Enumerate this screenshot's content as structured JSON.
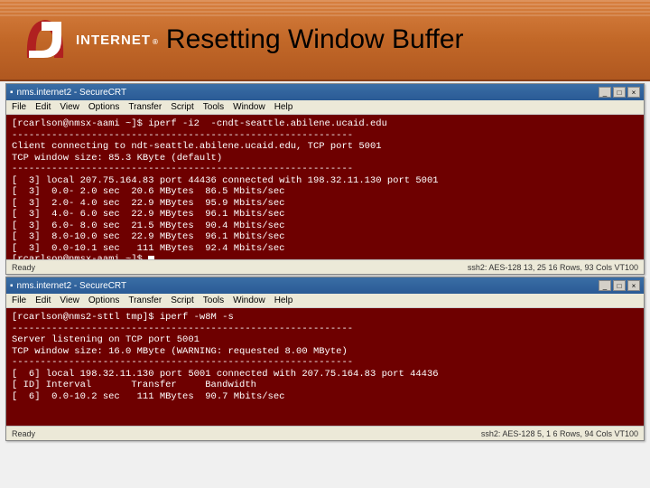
{
  "header": {
    "logo_word": "INTERNET",
    "logo_reg": "®",
    "title": "Resetting Window Buffer"
  },
  "term1": {
    "titlebar": "nms.internet2 - SecureCRT",
    "menus": [
      "File",
      "Edit",
      "View",
      "Options",
      "Transfer",
      "Script",
      "Tools",
      "Window",
      "Help"
    ],
    "lines": [
      "[rcarlson@nmsx-aami ~]$ iperf -i2  -cndt-seattle.abilene.ucaid.edu",
      "------------------------------------------------------------",
      "Client connecting to ndt-seattle.abilene.ucaid.edu, TCP port 5001",
      "TCP window size: 85.3 KByte (default)",
      "------------------------------------------------------------",
      "[  3] local 207.75.164.83 port 44436 connected with 198.32.11.130 port 5001",
      "[  3]  0.0- 2.0 sec  20.6 MBytes  86.5 Mbits/sec",
      "[  3]  2.0- 4.0 sec  22.9 MBytes  95.9 Mbits/sec",
      "[  3]  4.0- 6.0 sec  22.9 MBytes  96.1 Mbits/sec",
      "[  3]  6.0- 8.0 sec  21.5 MBytes  90.4 Mbits/sec",
      "[  3]  8.0-10.0 sec  22.9 MBytes  96.1 Mbits/sec",
      "[  3]  0.0-10.1 sec   111 MBytes  92.4 Mbits/sec",
      "[rcarlson@nmsx-aami ~]$ "
    ],
    "status_left": "Ready",
    "status_right": "ssh2: AES-128  13, 25   16 Rows, 93 Cols   VT100"
  },
  "term2": {
    "titlebar": "nms.internet2 - SecureCRT",
    "menus": [
      "File",
      "Edit",
      "View",
      "Options",
      "Transfer",
      "Script",
      "Tools",
      "Window",
      "Help"
    ],
    "lines": [
      "[rcarlson@nms2-sttl tmp]$ iperf -w8M -s",
      "------------------------------------------------------------",
      "Server listening on TCP port 5001",
      "TCP window size: 16.0 MByte (WARNING: requested 8.00 MByte)",
      "------------------------------------------------------------",
      "[  6] local 198.32.11.130 port 5001 connected with 207.75.164.83 port 44436",
      "[ ID] Interval       Transfer     Bandwidth",
      "[  6]  0.0-10.2 sec   111 MBytes  90.7 Mbits/sec"
    ],
    "status_left": "Ready",
    "status_right": "ssh2: AES-128   5,  1    6 Rows, 94 Cols   VT100"
  }
}
